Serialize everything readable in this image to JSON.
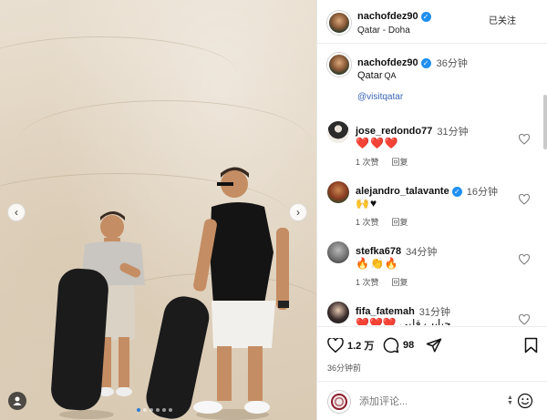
{
  "post": {
    "username": "nachofdez90",
    "location": "Qatar - Doha",
    "follow_state": "已关注",
    "caption_time": "36分钟",
    "caption_text": "Qatar",
    "caption_flag": "QA",
    "caption_link": "@visitqatar",
    "likes": "1.2 万",
    "comment_count": "98",
    "posted_ago": "36分钟前",
    "comment_placeholder": "添加评论..."
  },
  "comments": [
    {
      "user": "jose_redondo77",
      "verified": false,
      "time": "31分钟",
      "text": "❤️❤️❤️",
      "likes": "1 次赞",
      "reply": "回复"
    },
    {
      "user": "alejandro_talavante",
      "verified": true,
      "time": "16分钟",
      "text": "🙌♥",
      "likes": "1 次赞",
      "reply": "回复"
    },
    {
      "user": "stefka678",
      "verified": false,
      "time": "34分钟",
      "text": "🔥👏🔥",
      "likes": "1 次赞",
      "reply": "回复"
    },
    {
      "user": "fifa_fatemah",
      "verified": false,
      "time": "31分钟",
      "text": "❤️❤️❤️ حبايب قلبي",
      "likes": "",
      "reply": ""
    }
  ],
  "colors": {
    "verified_blue": "#1f8ff0",
    "link_blue": "#3a64b5",
    "heart_red": "#e0243a",
    "active_dot": "#2a7dd6"
  },
  "icons": {
    "like": "heart-icon",
    "comment": "comment-icon",
    "share": "send-icon",
    "save": "bookmark-icon",
    "emoji": "emoji-icon",
    "tags": "user-tag-icon"
  },
  "carousel": {
    "total": 6,
    "active": 1
  }
}
